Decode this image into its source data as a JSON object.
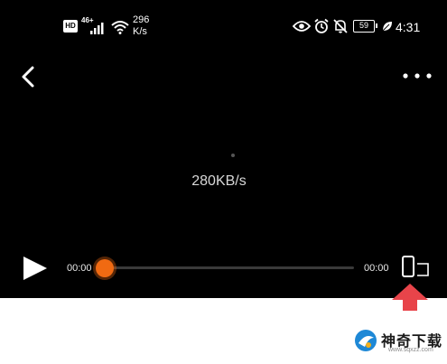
{
  "status_bar": {
    "hd": "HD",
    "network": "46+",
    "speed_value": "296",
    "speed_unit": "K/s",
    "battery": "59",
    "time": "4:31"
  },
  "player": {
    "buffer_rate": "280KB/s",
    "current_time": "00:00",
    "duration": "00:00",
    "progress": 0
  },
  "colors": {
    "player_bg": "#000000",
    "accent": "#f06a12",
    "arrow": "#e8444a"
  },
  "watermark": {
    "brand": "神奇下载",
    "url": "www.sqxzz.com"
  }
}
